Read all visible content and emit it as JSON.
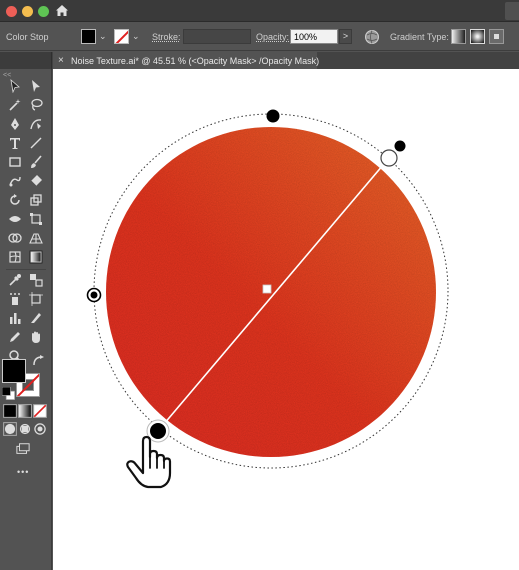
{
  "window": {
    "controls": [
      "close",
      "minimize",
      "zoom"
    ],
    "home_icon": "home-icon"
  },
  "controlbar": {
    "context_label": "Color Stop",
    "fill_color": "#000000",
    "stroke_label": "Stroke:",
    "stroke_value": "",
    "opacity_label": "Opacity:",
    "opacity_value": "100%",
    "opacity_arrow": ">",
    "gradient_type_label": "Gradient Type:",
    "gradient_types": [
      "linear",
      "radial",
      "freeform"
    ]
  },
  "document_tab": {
    "close": "×",
    "title": "Noise Texture.ai* @ 45.51 % (<Opacity Mask> /Opacity Mask)"
  },
  "toolbar": {
    "collapse": "<<",
    "fill_color": "#000000",
    "stroke_color": "#ffffff",
    "more_tools": "•••",
    "tools": [
      "selection-tool",
      "direct-selection-tool",
      "magic-wand-tool",
      "lasso-tool",
      "pen-tool",
      "curvature-tool",
      "type-tool",
      "line-tool",
      "rectangle-tool",
      "paintbrush-tool",
      "shaper-tool",
      "eraser-tool",
      "rotate-tool",
      "scale-tool",
      "width-tool",
      "free-transform-tool",
      "shape-builder-tool",
      "perspective-grid-tool",
      "mesh-tool",
      "gradient-tool",
      "eyedropper-tool",
      "blend-tool",
      "symbol-sprayer-tool",
      "artboard-tool",
      "column-graph-tool",
      "slice-tool",
      "pencil-tool",
      "hand-tool",
      "zoom-tool"
    ]
  },
  "artwork": {
    "colors": {
      "gradient_start": "#e62d24",
      "gradient_end": "#f06a2a",
      "canvas": "#ffffff"
    },
    "gradient_annotator": "radial-gradient-annotator",
    "cursor": "hand-pointer-cursor"
  }
}
